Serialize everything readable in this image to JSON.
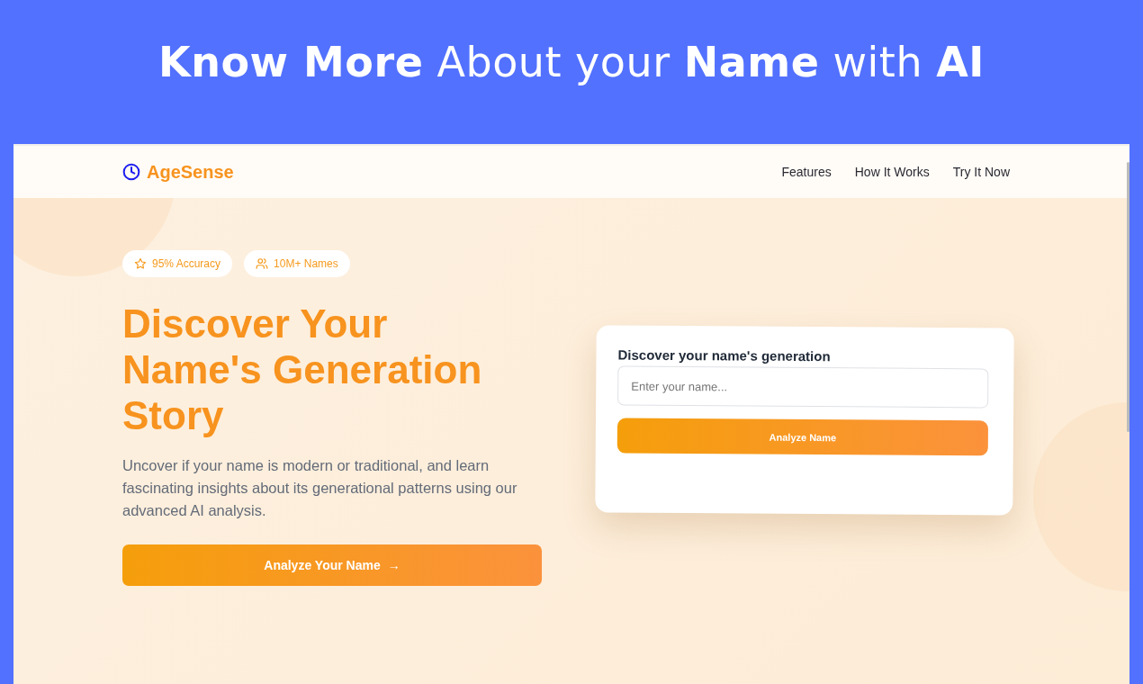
{
  "banner": {
    "headline": "**Know More** About your **Name** with **AI**"
  },
  "nav": {
    "brand": "AgeSense",
    "links": [
      "Features",
      "How It Works",
      "Try It Now"
    ]
  },
  "hero": {
    "badges": [
      "95% Accuracy",
      "10M+ Names"
    ],
    "title": "Discover Your Name's Generation Story",
    "description": "Uncover if your name is modern or traditional, and learn fascinating insights about its generational patterns using our advanced AI analysis.",
    "cta": "Analyze Your Name",
    "arrow": "→"
  },
  "form_card": {
    "label": "Discover your name's generation",
    "placeholder": "Enter your name...",
    "button": "Analyze Name"
  }
}
